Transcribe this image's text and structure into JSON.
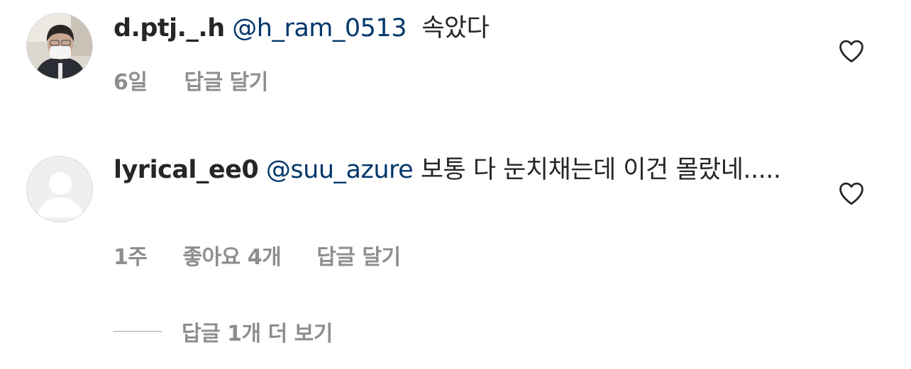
{
  "comments": [
    {
      "username": "d.ptj._.h",
      "mention": "@h_ram_0513",
      "text": "속았다",
      "time": "6일",
      "likes": "",
      "reply_label": "답글 달기"
    },
    {
      "username": "lyrical_ee0",
      "mention": "@suu_azure",
      "text": "보통 다 눈치채는데 이건 몰랐네.....",
      "time": "1주",
      "likes": "좋아요 4개",
      "reply_label": "답글 달기"
    }
  ],
  "view_replies_label": "답글 1개 더 보기",
  "icons": {
    "like": "heart-outline-icon",
    "avatar_default": "default-avatar-icon"
  },
  "colors": {
    "text": "#262626",
    "mention": "#00376b",
    "meta": "#8e8e8e",
    "divider": "#c7c7c7"
  }
}
